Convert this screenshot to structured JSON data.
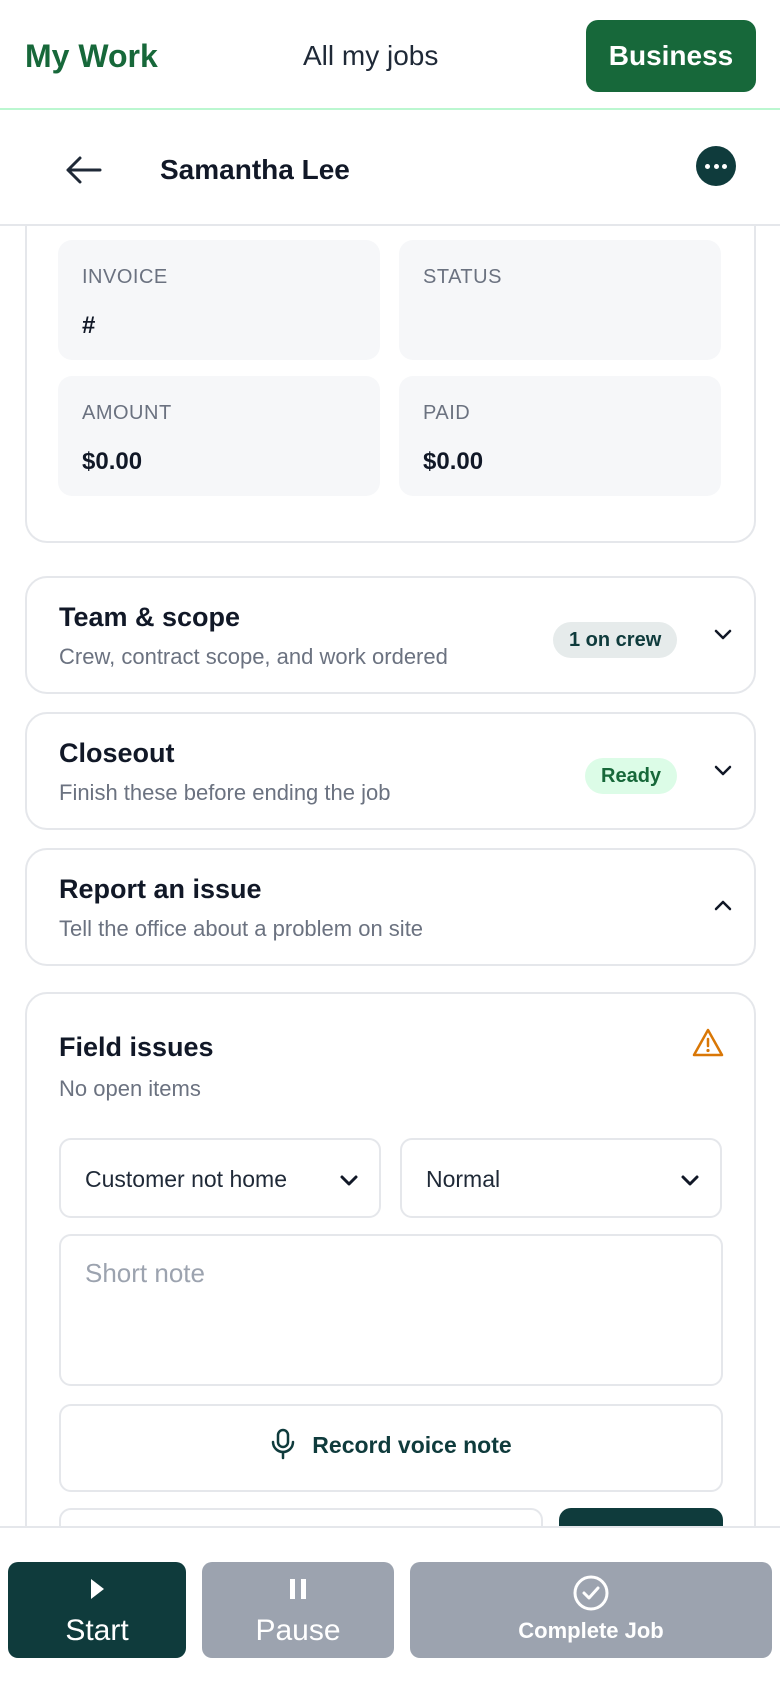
{
  "nav": {
    "brand": "My Work",
    "link": "All my jobs",
    "business_button": "Business"
  },
  "header": {
    "customer_name": "Samantha Lee"
  },
  "invoice": {
    "invoice_label": "INVOICE",
    "invoice_value": "#",
    "status_label": "STATUS",
    "status_value": "",
    "amount_label": "AMOUNT",
    "amount_value": "$0.00",
    "paid_label": "PAID",
    "paid_value": "$0.00"
  },
  "sections": {
    "team": {
      "title": "Team & scope",
      "subtitle": "Crew, contract scope, and work ordered",
      "badge": "1 on crew"
    },
    "closeout": {
      "title": "Closeout",
      "subtitle": "Finish these before ending the job",
      "badge": "Ready"
    },
    "report": {
      "title": "Report an issue",
      "subtitle": "Tell the office about a problem on site"
    }
  },
  "field_issues": {
    "title": "Field issues",
    "subtitle": "No open items",
    "issue_type_selected": "Customer not home",
    "priority_selected": "Normal",
    "note_placeholder": "Short note",
    "voice_button": "Record voice note"
  },
  "actions": {
    "start": "Start",
    "pause": "Pause",
    "complete": "Complete Job"
  },
  "colors": {
    "brand_green": "#17683a",
    "dark_teal": "#0f3b3c",
    "disabled_gray": "#9ca3af",
    "warning_orange": "#d97706"
  }
}
